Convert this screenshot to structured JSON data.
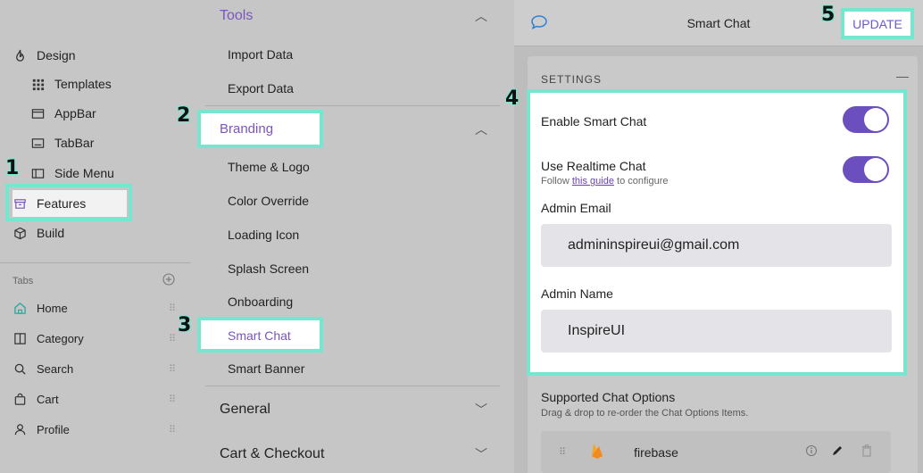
{
  "left_nav": {
    "items": [
      {
        "label": "Design",
        "icon": "flame-icon"
      },
      {
        "label": "Templates",
        "icon": "grid-icon"
      },
      {
        "label": "AppBar",
        "icon": "appbar-icon"
      },
      {
        "label": "TabBar",
        "icon": "tabbar-icon"
      },
      {
        "label": "Side Menu",
        "icon": "sidemenu-icon"
      },
      {
        "label": "Features",
        "icon": "archive-icon"
      },
      {
        "label": "Build",
        "icon": "cube-icon"
      }
    ],
    "tabs_label": "Tabs",
    "tabs": [
      {
        "label": "Home",
        "icon": "home-icon"
      },
      {
        "label": "Category",
        "icon": "category-icon"
      },
      {
        "label": "Search",
        "icon": "search-icon"
      },
      {
        "label": "Cart",
        "icon": "cart-icon"
      },
      {
        "label": "Profile",
        "icon": "user-icon"
      }
    ]
  },
  "middle": {
    "tools_header": "Tools",
    "tools_items": [
      "Import Data",
      "Export Data"
    ],
    "branding_header": "Branding",
    "branding_items": [
      "Theme & Logo",
      "Color Override",
      "Loading Icon",
      "Splash Screen",
      "Onboarding",
      "Smart Chat",
      "Smart Banner"
    ],
    "general_header": "General",
    "cart_header": "Cart & Checkout"
  },
  "right": {
    "title": "Smart Chat",
    "update_label": "UPDATE",
    "settings_label": "SETTINGS",
    "collapse_symbol": "—",
    "enable_label": "Enable Smart Chat",
    "realtime_label": "Use Realtime Chat",
    "realtime_sub_prefix": "Follow",
    "realtime_sub_link": "this guide",
    "realtime_sub_suffix": "to configure",
    "admin_email_label": "Admin Email",
    "admin_email_value": "admininspireui@gmail.com",
    "admin_name_label": "Admin Name",
    "admin_name_value": "InspireUI",
    "supported_title": "Supported Chat Options",
    "supported_sub": "Drag & drop to re-order the Chat Options Items.",
    "options": [
      {
        "label": "firebase",
        "icon": "firebase-icon"
      }
    ]
  },
  "callouts": [
    "1",
    "2",
    "3",
    "4",
    "5"
  ],
  "colors": {
    "accent": "#6b4fbf",
    "highlight": "#76e6cf",
    "link": "#7a55c0"
  }
}
